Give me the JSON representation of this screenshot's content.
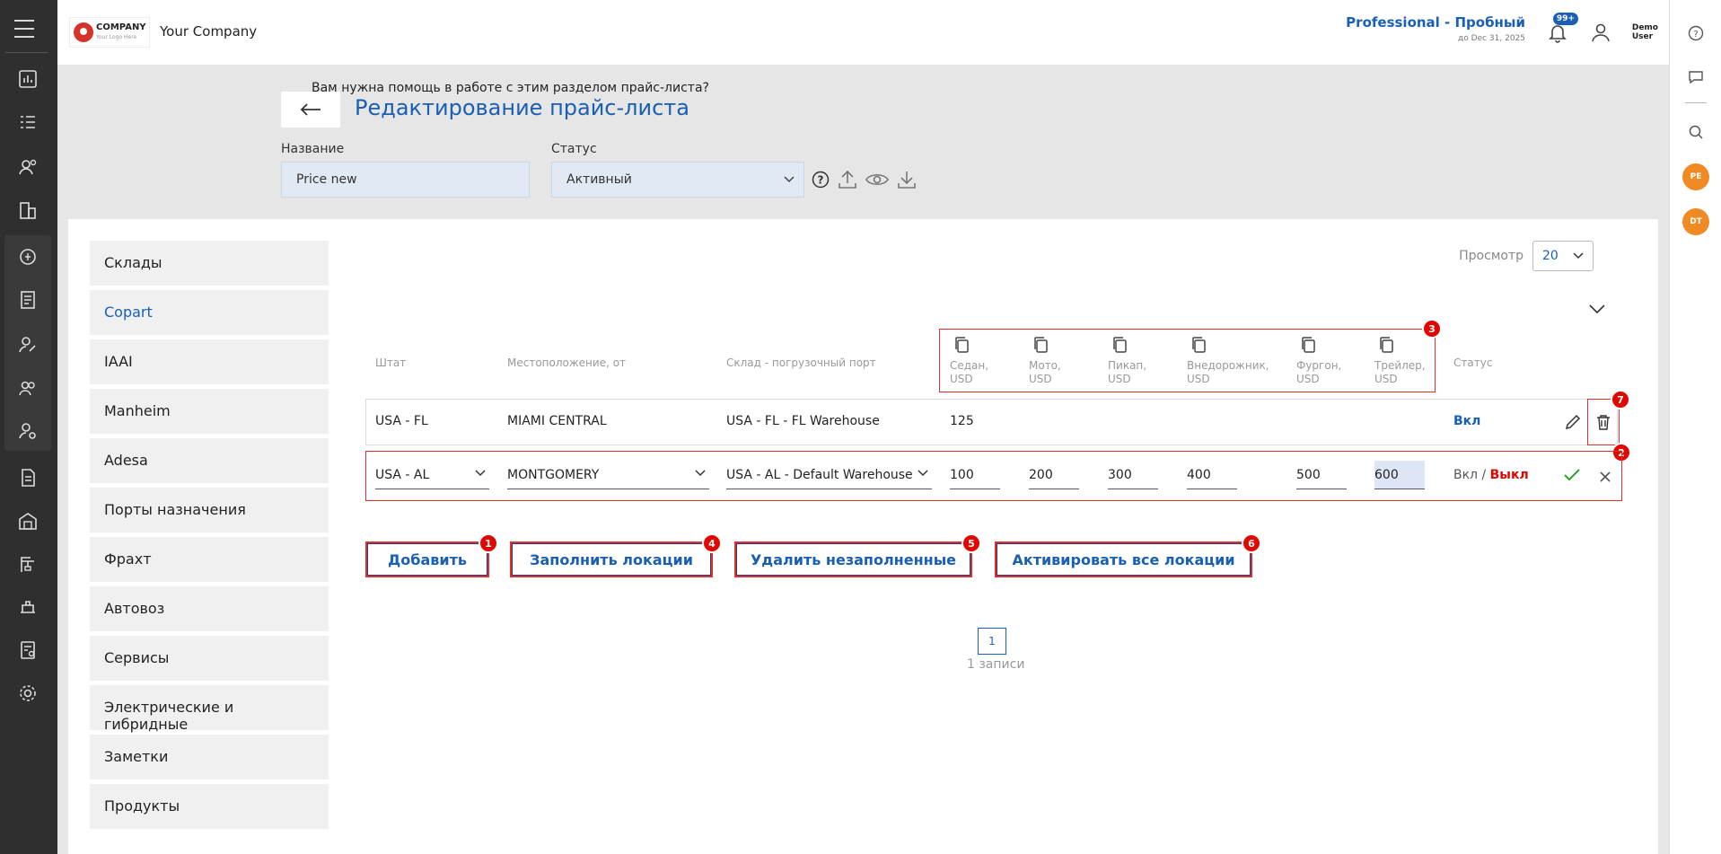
{
  "header": {
    "logo_text": "COMPANY",
    "logo_tagline": "Your Logo Here",
    "company_name": "Your Company",
    "plan_name": "Professional - Пробный",
    "plan_expiry": "до Dec 31, 2025",
    "notifications_badge": "99+",
    "user_first": "Demo",
    "user_last": "User"
  },
  "page": {
    "title": "Редактирование прайс-листа",
    "name_label": "Название",
    "name_value": "Price new",
    "status_label": "Статус",
    "status_value": "Активный"
  },
  "sidebar": {
    "items": [
      {
        "label": "Склады"
      },
      {
        "label": "Copart"
      },
      {
        "label": "IAAI"
      },
      {
        "label": "Manheim"
      },
      {
        "label": "Adesa"
      },
      {
        "label": "Порты назначения"
      },
      {
        "label": "Фрахт"
      },
      {
        "label": "Автовоз"
      },
      {
        "label": "Сервисы"
      },
      {
        "label": "Электрические и гибридные"
      },
      {
        "label": "Заметки"
      },
      {
        "label": "Продукты"
      }
    ],
    "active_index": 1
  },
  "view": {
    "label": "Просмотр",
    "value": "20"
  },
  "help_text": "Вам нужна помощь в работе с этим разделом прайс-листа?",
  "table": {
    "headers": {
      "state": "Штат",
      "location": "Местоположение, от",
      "warehouse": "Склад - погрузочный порт",
      "status": "Статус"
    },
    "vehicles": [
      {
        "l1": "Седан,",
        "l2": "USD"
      },
      {
        "l1": "Мото,",
        "l2": "USD"
      },
      {
        "l1": "Пикап,",
        "l2": "USD"
      },
      {
        "l1": "Внедорожник,",
        "l2": "USD"
      },
      {
        "l1": "Фургон,",
        "l2": "USD"
      },
      {
        "l1": "Трейлер,",
        "l2": "USD"
      }
    ],
    "row1": {
      "state": "USA - FL",
      "location": "MIAMI CENTRAL",
      "warehouse": "USA - FL - FL Warehouse",
      "sedan": "125",
      "status": "Вкл"
    },
    "row2": {
      "state": "USA - AL",
      "location": "MONTGOMERY",
      "warehouse": "USA - AL - Default Warehouse",
      "sedan": "100",
      "moto": "200",
      "pickup": "300",
      "suv": "400",
      "van": "500",
      "trailer": "600",
      "status_on": "Вкл",
      "status_sep": "/",
      "status_off": "Выкл"
    }
  },
  "actions": {
    "add": "Добавить",
    "fill": "Заполнить локации",
    "remove": "Удалить незаполненные",
    "activate": "Активировать все локации"
  },
  "markers": [
    "1",
    "2",
    "3",
    "4",
    "5",
    "6",
    "7"
  ],
  "pagination": {
    "page": "1",
    "records": "1 записи"
  },
  "right_rail": {
    "bubble1": "PE",
    "bubble2": "DT"
  },
  "colors": {
    "accent": "#1a5fb4",
    "danger": "#e10600",
    "success": "#2ca02c"
  }
}
